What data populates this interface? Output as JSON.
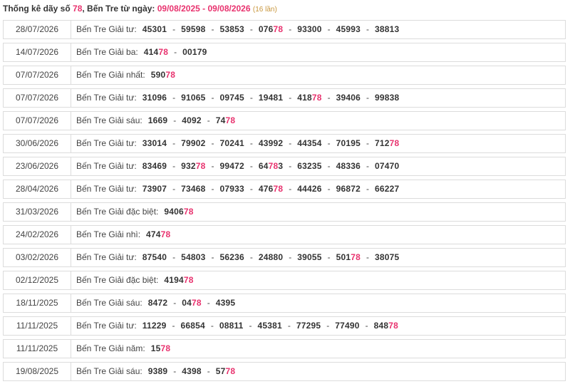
{
  "header": {
    "prefix": "Thống kê dãy số ",
    "number": "78",
    "mid": ", Bến Tre từ ngày: ",
    "range": "09/08/2025 - 09/08/2026",
    "count": "(16 lần)"
  },
  "colors": {
    "highlight": "#e8326e",
    "count": "#c8963c",
    "border": "#dcdcdc"
  },
  "rows": [
    {
      "date": "28/07/2026",
      "prize": "Bến Tre Giải tư:",
      "numbers": [
        {
          "pre": "45301",
          "hit": "",
          "post": ""
        },
        {
          "pre": "59598",
          "hit": "",
          "post": ""
        },
        {
          "pre": "53853",
          "hit": "",
          "post": ""
        },
        {
          "pre": "076",
          "hit": "78",
          "post": ""
        },
        {
          "pre": "93300",
          "hit": "",
          "post": ""
        },
        {
          "pre": "45993",
          "hit": "",
          "post": ""
        },
        {
          "pre": "38813",
          "hit": "",
          "post": ""
        }
      ]
    },
    {
      "date": "14/07/2026",
      "prize": "Bến Tre Giải ba:",
      "numbers": [
        {
          "pre": "414",
          "hit": "78",
          "post": ""
        },
        {
          "pre": "00179",
          "hit": "",
          "post": ""
        }
      ]
    },
    {
      "date": "07/07/2026",
      "prize": "Bến Tre Giải nhất:",
      "numbers": [
        {
          "pre": "590",
          "hit": "78",
          "post": ""
        }
      ]
    },
    {
      "date": "07/07/2026",
      "prize": "Bến Tre Giải tư:",
      "numbers": [
        {
          "pre": "31096",
          "hit": "",
          "post": ""
        },
        {
          "pre": "91065",
          "hit": "",
          "post": ""
        },
        {
          "pre": "09745",
          "hit": "",
          "post": ""
        },
        {
          "pre": "19481",
          "hit": "",
          "post": ""
        },
        {
          "pre": "418",
          "hit": "78",
          "post": ""
        },
        {
          "pre": "39406",
          "hit": "",
          "post": ""
        },
        {
          "pre": "99838",
          "hit": "",
          "post": ""
        }
      ]
    },
    {
      "date": "07/07/2026",
      "prize": "Bến Tre Giải sáu:",
      "numbers": [
        {
          "pre": "1669",
          "hit": "",
          "post": ""
        },
        {
          "pre": "4092",
          "hit": "",
          "post": ""
        },
        {
          "pre": "74",
          "hit": "78",
          "post": ""
        }
      ]
    },
    {
      "date": "30/06/2026",
      "prize": "Bến Tre Giải tư:",
      "numbers": [
        {
          "pre": "33014",
          "hit": "",
          "post": ""
        },
        {
          "pre": "79902",
          "hit": "",
          "post": ""
        },
        {
          "pre": "70241",
          "hit": "",
          "post": ""
        },
        {
          "pre": "43992",
          "hit": "",
          "post": ""
        },
        {
          "pre": "44354",
          "hit": "",
          "post": ""
        },
        {
          "pre": "70195",
          "hit": "",
          "post": ""
        },
        {
          "pre": "712",
          "hit": "78",
          "post": ""
        }
      ]
    },
    {
      "date": "23/06/2026",
      "prize": "Bến Tre Giải tư:",
      "numbers": [
        {
          "pre": "83469",
          "hit": "",
          "post": ""
        },
        {
          "pre": "932",
          "hit": "78",
          "post": ""
        },
        {
          "pre": "99472",
          "hit": "",
          "post": ""
        },
        {
          "pre": "64",
          "hit": "78",
          "post": "3"
        },
        {
          "pre": "63235",
          "hit": "",
          "post": ""
        },
        {
          "pre": "48336",
          "hit": "",
          "post": ""
        },
        {
          "pre": "07470",
          "hit": "",
          "post": ""
        }
      ]
    },
    {
      "date": "28/04/2026",
      "prize": "Bến Tre Giải tư:",
      "numbers": [
        {
          "pre": "73907",
          "hit": "",
          "post": ""
        },
        {
          "pre": "73468",
          "hit": "",
          "post": ""
        },
        {
          "pre": "07933",
          "hit": "",
          "post": ""
        },
        {
          "pre": "476",
          "hit": "78",
          "post": ""
        },
        {
          "pre": "44426",
          "hit": "",
          "post": ""
        },
        {
          "pre": "96872",
          "hit": "",
          "post": ""
        },
        {
          "pre": "66227",
          "hit": "",
          "post": ""
        }
      ]
    },
    {
      "date": "31/03/2026",
      "prize": "Bến Tre Giải đặc biệt:",
      "numbers": [
        {
          "pre": "9406",
          "hit": "78",
          "post": ""
        }
      ]
    },
    {
      "date": "24/02/2026",
      "prize": "Bến Tre Giải nhì:",
      "numbers": [
        {
          "pre": "474",
          "hit": "78",
          "post": ""
        }
      ]
    },
    {
      "date": "03/02/2026",
      "prize": "Bến Tre Giải tư:",
      "numbers": [
        {
          "pre": "87540",
          "hit": "",
          "post": ""
        },
        {
          "pre": "54803",
          "hit": "",
          "post": ""
        },
        {
          "pre": "56236",
          "hit": "",
          "post": ""
        },
        {
          "pre": "24880",
          "hit": "",
          "post": ""
        },
        {
          "pre": "39055",
          "hit": "",
          "post": ""
        },
        {
          "pre": "501",
          "hit": "78",
          "post": ""
        },
        {
          "pre": "38075",
          "hit": "",
          "post": ""
        }
      ]
    },
    {
      "date": "02/12/2025",
      "prize": "Bến Tre Giải đặc biệt:",
      "numbers": [
        {
          "pre": "4194",
          "hit": "78",
          "post": ""
        }
      ]
    },
    {
      "date": "18/11/2025",
      "prize": "Bến Tre Giải sáu:",
      "numbers": [
        {
          "pre": "8472",
          "hit": "",
          "post": ""
        },
        {
          "pre": "04",
          "hit": "78",
          "post": ""
        },
        {
          "pre": "4395",
          "hit": "",
          "post": ""
        }
      ]
    },
    {
      "date": "11/11/2025",
      "prize": "Bến Tre Giải tư:",
      "numbers": [
        {
          "pre": "11229",
          "hit": "",
          "post": ""
        },
        {
          "pre": "66854",
          "hit": "",
          "post": ""
        },
        {
          "pre": "08811",
          "hit": "",
          "post": ""
        },
        {
          "pre": "45381",
          "hit": "",
          "post": ""
        },
        {
          "pre": "77295",
          "hit": "",
          "post": ""
        },
        {
          "pre": "77490",
          "hit": "",
          "post": ""
        },
        {
          "pre": "848",
          "hit": "78",
          "post": ""
        }
      ]
    },
    {
      "date": "11/11/2025",
      "prize": "Bến Tre Giải năm:",
      "numbers": [
        {
          "pre": "15",
          "hit": "78",
          "post": ""
        }
      ]
    },
    {
      "date": "19/08/2025",
      "prize": "Bến Tre Giải sáu:",
      "numbers": [
        {
          "pre": "9389",
          "hit": "",
          "post": ""
        },
        {
          "pre": "4398",
          "hit": "",
          "post": ""
        },
        {
          "pre": "57",
          "hit": "78",
          "post": ""
        }
      ]
    }
  ]
}
